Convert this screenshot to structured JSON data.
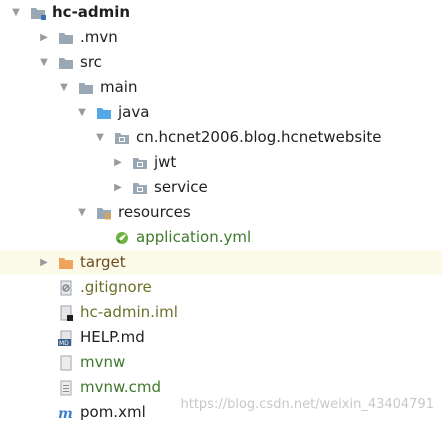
{
  "project": {
    "root": "hc-admin",
    "items": [
      {
        "label": "hc-admin"
      },
      {
        "label": ".mvn"
      },
      {
        "label": "src"
      },
      {
        "label": "main"
      },
      {
        "label": "java"
      },
      {
        "label": "cn.hcnet2006.blog.hcnetwebsite"
      },
      {
        "label": "jwt"
      },
      {
        "label": "service"
      },
      {
        "label": "resources"
      },
      {
        "label": "application.yml"
      },
      {
        "label": "target"
      },
      {
        "label": ".gitignore"
      },
      {
        "label": "hc-admin.iml"
      },
      {
        "label": "HELP.md"
      },
      {
        "label": "mvnw"
      },
      {
        "label": "mvnw.cmd"
      },
      {
        "label": "pom.xml"
      }
    ]
  },
  "watermark": "https://blog.csdn.net/weixin_43404791",
  "colors": {
    "folder": "#9aa7b5",
    "blue_folder": "#55a8e6",
    "orange_folder": "#f0a35e",
    "highlight_row": "#fcfbe9",
    "green_text": "#3d7a2b"
  }
}
